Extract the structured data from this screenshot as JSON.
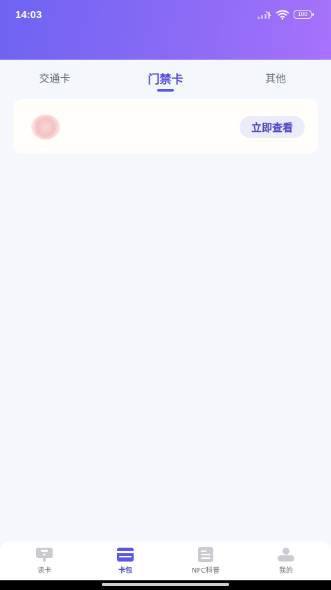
{
  "status_bar": {
    "time": "14:03",
    "battery": "100"
  },
  "tabs": [
    {
      "label": "交通卡",
      "active": false
    },
    {
      "label": "门禁卡",
      "active": true
    },
    {
      "label": "其他",
      "active": false
    }
  ],
  "card": {
    "button_label": "立即查看"
  },
  "bottom_nav": [
    {
      "label": "读卡",
      "icon": "card-reader-icon",
      "active": false
    },
    {
      "label": "卡包",
      "icon": "card-wallet-icon",
      "active": true
    },
    {
      "label": "NFC科普",
      "icon": "document-icon",
      "active": false
    },
    {
      "label": "我的",
      "icon": "profile-icon",
      "active": false
    }
  ],
  "colors": {
    "accent": "#5b57e6",
    "header_start": "#6e63f2",
    "header_end": "#a772fb"
  }
}
